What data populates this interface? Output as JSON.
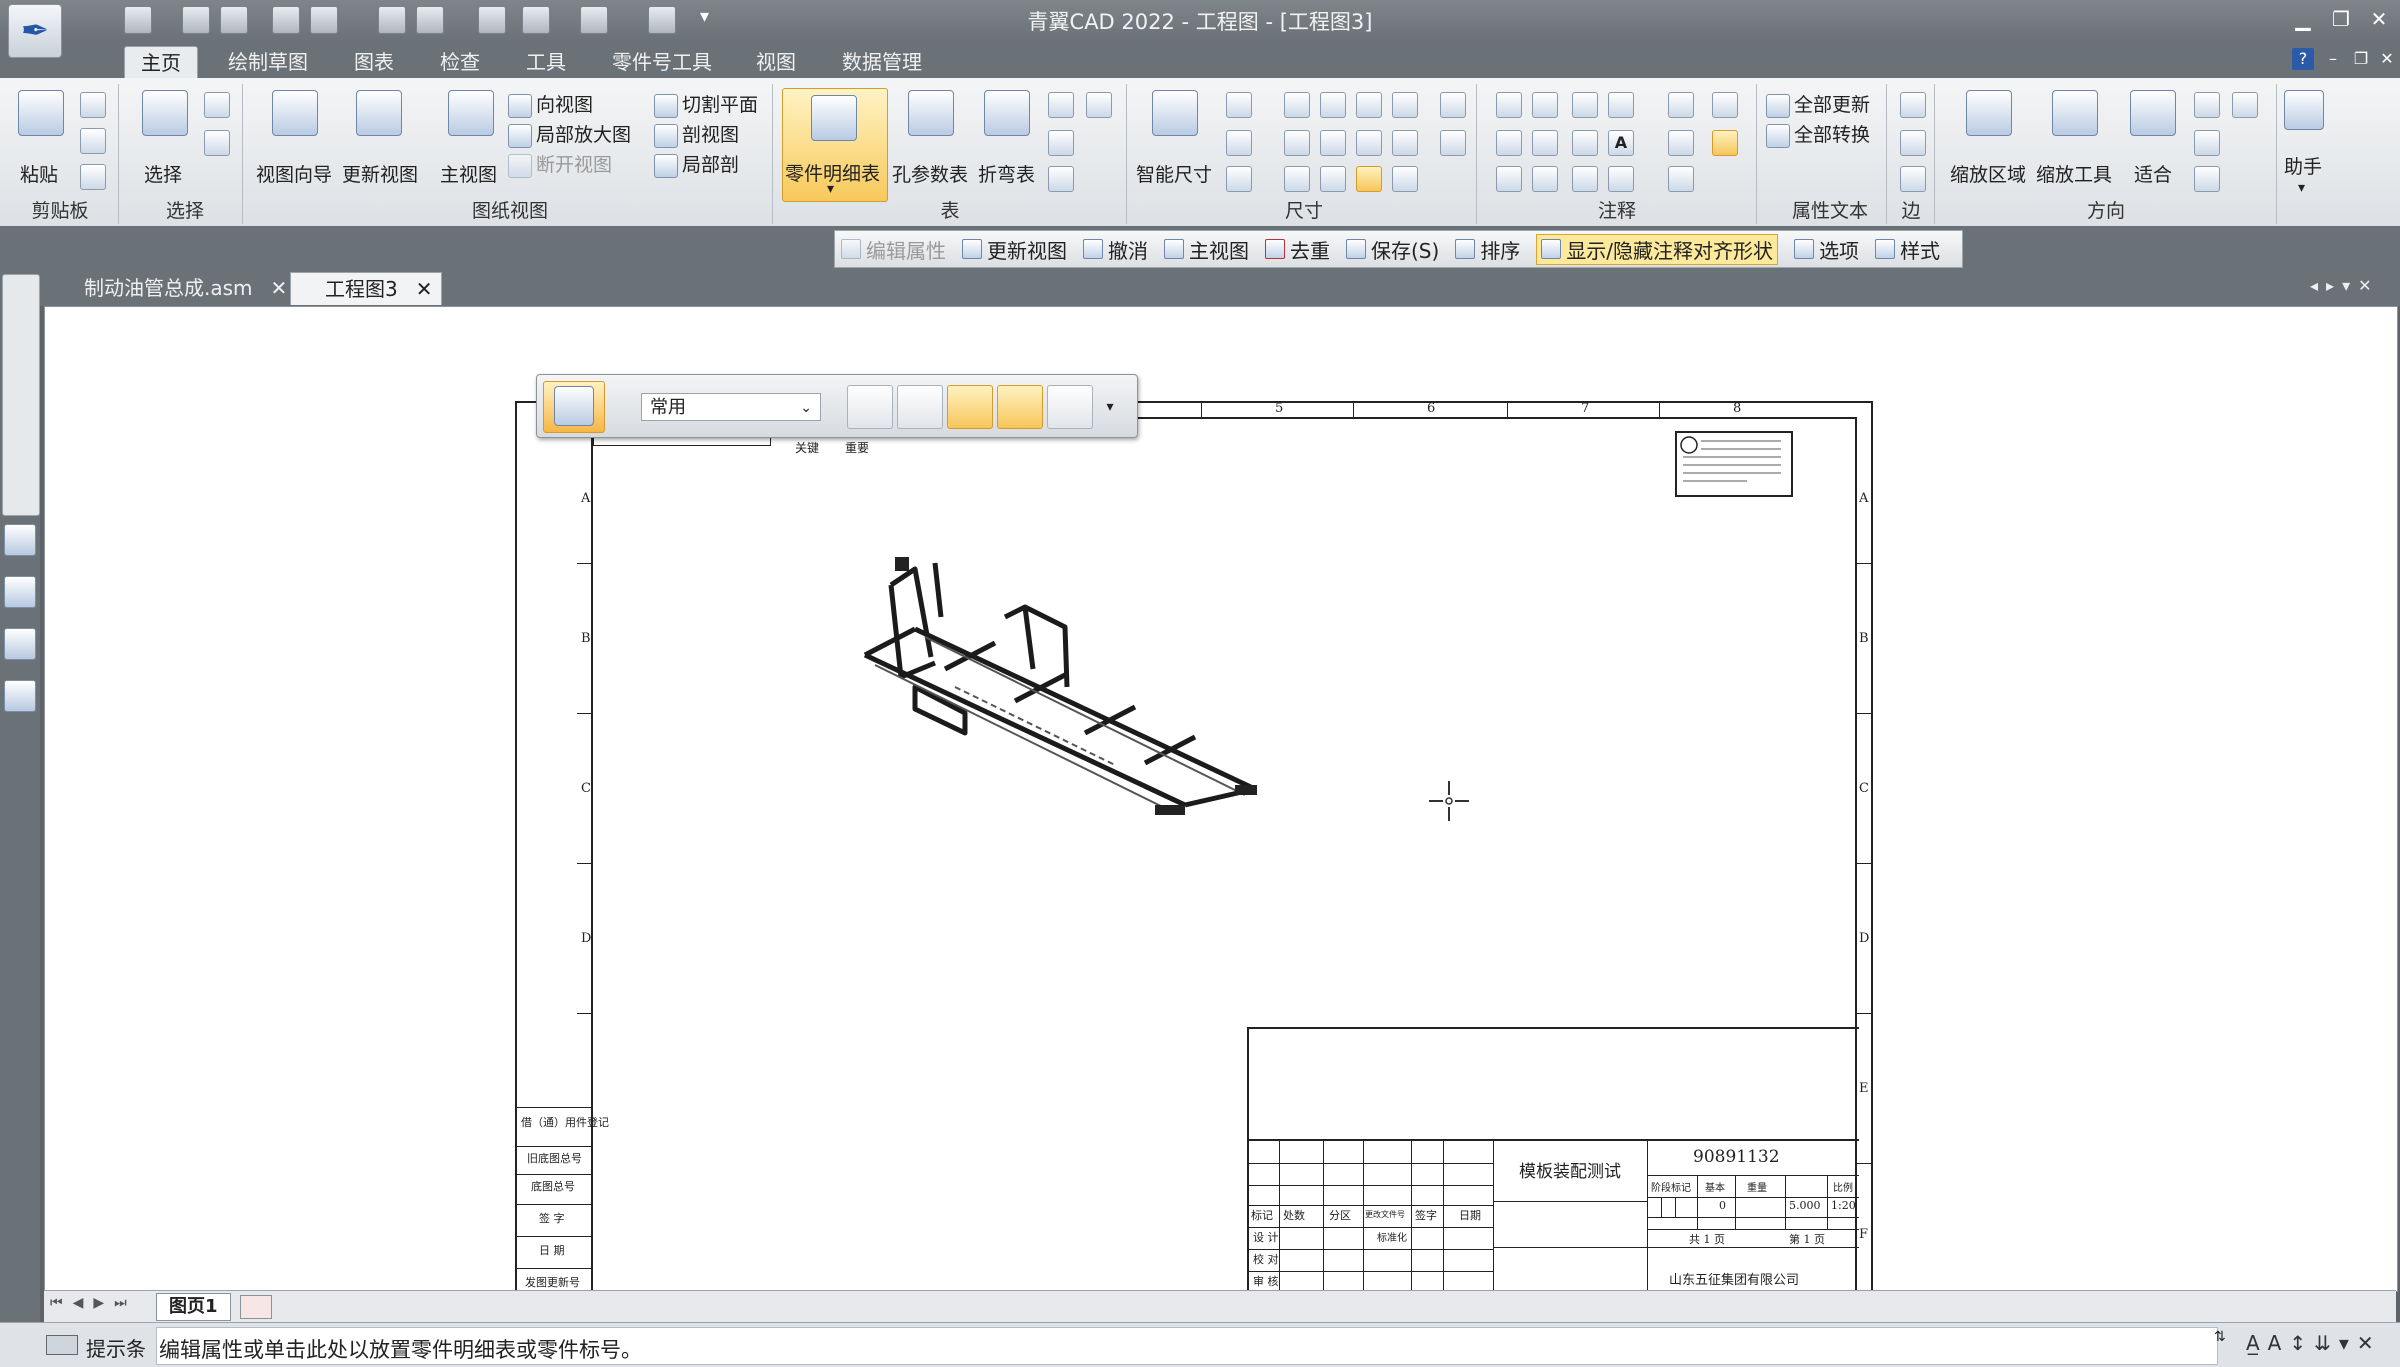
{
  "window": {
    "title": "青翼CAD 2022 - 工程图 - [工程图3]"
  },
  "ribbon_tabs": [
    "主页",
    "绘制草图",
    "图表",
    "检查",
    "工具",
    "零件号工具",
    "视图",
    "数据管理"
  ],
  "groups": {
    "clipboard": {
      "label": "剪贴板",
      "paste": "粘贴"
    },
    "select": {
      "label": "选择",
      "select": "选择"
    },
    "drawing_views": {
      "label": "图纸视图",
      "view_wizard": "视图向导",
      "update_view": "更新视图",
      "main_view": "主视图",
      "directional_view": "向视图",
      "detail_view": "局部放大图",
      "broken_view": "断开视图",
      "cut_plane": "切割平面",
      "section_view": "剖视图",
      "partial_section": "局部剖"
    },
    "tables": {
      "label": "表",
      "parts_list": "零件明细表",
      "hole_table": "孔参数表",
      "bend_table": "折弯表"
    },
    "dimensions": {
      "label": "尺寸",
      "smart_dimension": "智能尺寸"
    },
    "annotations": {
      "label": "注释"
    },
    "property_text": {
      "label": "属性文本",
      "update_all": "全部更新",
      "convert_all": "全部转换"
    },
    "edge": {
      "label": "边"
    },
    "orientation": {
      "label": "方向",
      "zoom_area": "缩放区域",
      "zoom_tool": "缩放工具",
      "fit": "适合"
    },
    "assistant": {
      "label": "助手"
    }
  },
  "command_bar": {
    "edit_properties": "编辑属性",
    "update_view": "更新视图",
    "undo": "撤消",
    "main_view": "主视图",
    "dedupe": "去重",
    "save": "保存(S)",
    "sort": "排序",
    "toggle_annotation": "显示/隐藏注释对齐形状",
    "options": "选项",
    "style": "样式"
  },
  "doc_tabs": [
    {
      "label": "制动油管总成.asm"
    },
    {
      "label": "工程图3"
    }
  ],
  "float_toolbar": {
    "style_value": "常用"
  },
  "drawing": {
    "drawing_number": "90891132",
    "drawing_name": "模板装配测试",
    "company": "山东五征集团有限公司",
    "scale": "1:20",
    "weight": "5.000",
    "qty": "0",
    "total_sheets": "共 1 页",
    "sheet_no": "第 1 页",
    "zone_cols": [
      "5",
      "6",
      "7",
      "8"
    ],
    "zone_rows": [
      "A",
      "B",
      "C",
      "D",
      "E",
      "F"
    ],
    "tb_header": [
      "标记",
      "处数",
      "分区",
      "更改文件号",
      "签字",
      "日期"
    ],
    "tb_roles": [
      "设 计",
      "校 对",
      "审 核"
    ],
    "tb_standard": "标准化",
    "tb_stage": [
      "阶段标记",
      "基本",
      "重量",
      "比例"
    ],
    "side_labels": [
      "借（通）用件登记",
      "旧底图总号",
      "底图总号",
      "签 字",
      "日 期",
      "发图更新号"
    ],
    "small_marks": [
      "关键",
      "重要"
    ]
  },
  "page_tabs": {
    "sheet1": "图页1"
  },
  "status": {
    "label": "提示条",
    "message": "编辑属性或单击此处以放置零件明细表或零件标号。"
  },
  "colors": {
    "ribbon_bg": "#e4e7ea",
    "chrome": "#6b7277",
    "highlight": "#f7c95b"
  }
}
